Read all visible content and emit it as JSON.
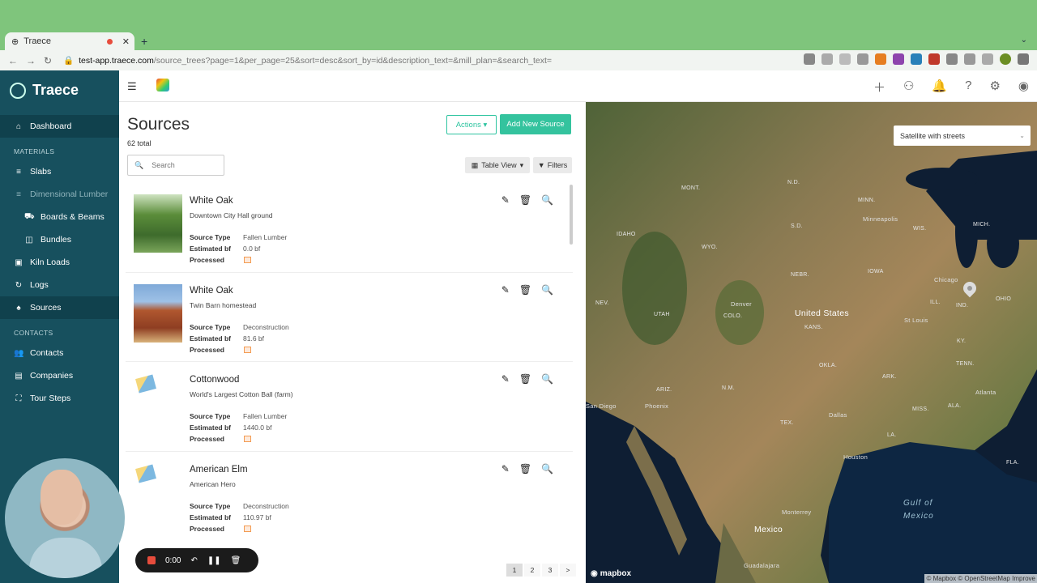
{
  "browser": {
    "tab_title": "Traece",
    "url_host": "test-app.traece.com",
    "url_path": "/source_trees?page=1&per_page=25&sort=desc&sort_by=id&description_text=&mill_plan=&search_text="
  },
  "sidebar": {
    "app_name": "Traece",
    "dashboard": "Dashboard",
    "materials_heading": "MATERIALS",
    "slabs": "Slabs",
    "dimensional_lumber": "Dimensional Lumber",
    "boards_beams": "Boards & Beams",
    "bundles": "Bundles",
    "kiln_loads": "Kiln Loads",
    "logs": "Logs",
    "sources": "Sources",
    "contacts_heading": "CONTACTS",
    "contacts": "Contacts",
    "companies": "Companies",
    "tour_steps": "Tour Steps"
  },
  "main": {
    "title": "Sources",
    "total": "62 total",
    "actions_label": "Actions",
    "add_label": "Add New Source",
    "search_placeholder": "Search",
    "table_view_label": "Table View",
    "filters_label": "Filters",
    "field_labels": {
      "source_type": "Source Type",
      "estimated_bf": "Estimated bf",
      "processed": "Processed"
    },
    "sources": [
      {
        "name": "White Oak",
        "description": "Downtown City Hall ground",
        "source_type": "Fallen Lumber",
        "estimated_bf": "0.0 bf"
      },
      {
        "name": "White Oak",
        "description": "Twin Barn homestead",
        "source_type": "Deconstruction",
        "estimated_bf": "81.6 bf"
      },
      {
        "name": "Cottonwood",
        "description": "World's Largest Cotton Ball (farm)",
        "source_type": "Fallen Lumber",
        "estimated_bf": "1440.0 bf"
      },
      {
        "name": "American Elm",
        "description": "American Hero",
        "source_type": "Deconstruction",
        "estimated_bf": "110.97 bf"
      }
    ],
    "pages": [
      "1",
      "2",
      "3",
      ">"
    ]
  },
  "recorder": {
    "time": "0:00"
  },
  "map": {
    "layer_select": "Satellite with streets",
    "country_label": "United States",
    "mexico_label": "Mexico",
    "gulf_label_1": "Gulf of",
    "gulf_label_2": "Mexico",
    "logo": "mapbox",
    "attribution": "© Mapbox © OpenStreetMap  Improve",
    "states": [
      "MONT.",
      "N.D.",
      "MINN.",
      "S.D.",
      "WIS.",
      "MICH.",
      "IDAHO",
      "WYO.",
      "IOWA",
      "NEBR.",
      "NEV.",
      "UTAH",
      "COLO.",
      "KANS.",
      "ILL.",
      "IND.",
      "OHIO",
      "KY.",
      "TENN.",
      "OKLA.",
      "ARK.",
      "ARIZ.",
      "N.M.",
      "TEX.",
      "MISS.",
      "ALA.",
      "LA.",
      "FLA."
    ],
    "cities": [
      "Minneapolis",
      "Chicago",
      "Denver",
      "St Louis",
      "Phoenix",
      "San Diego",
      "Dallas",
      "Houston",
      "Atlanta",
      "Monterrey",
      "Guadalajara"
    ]
  }
}
